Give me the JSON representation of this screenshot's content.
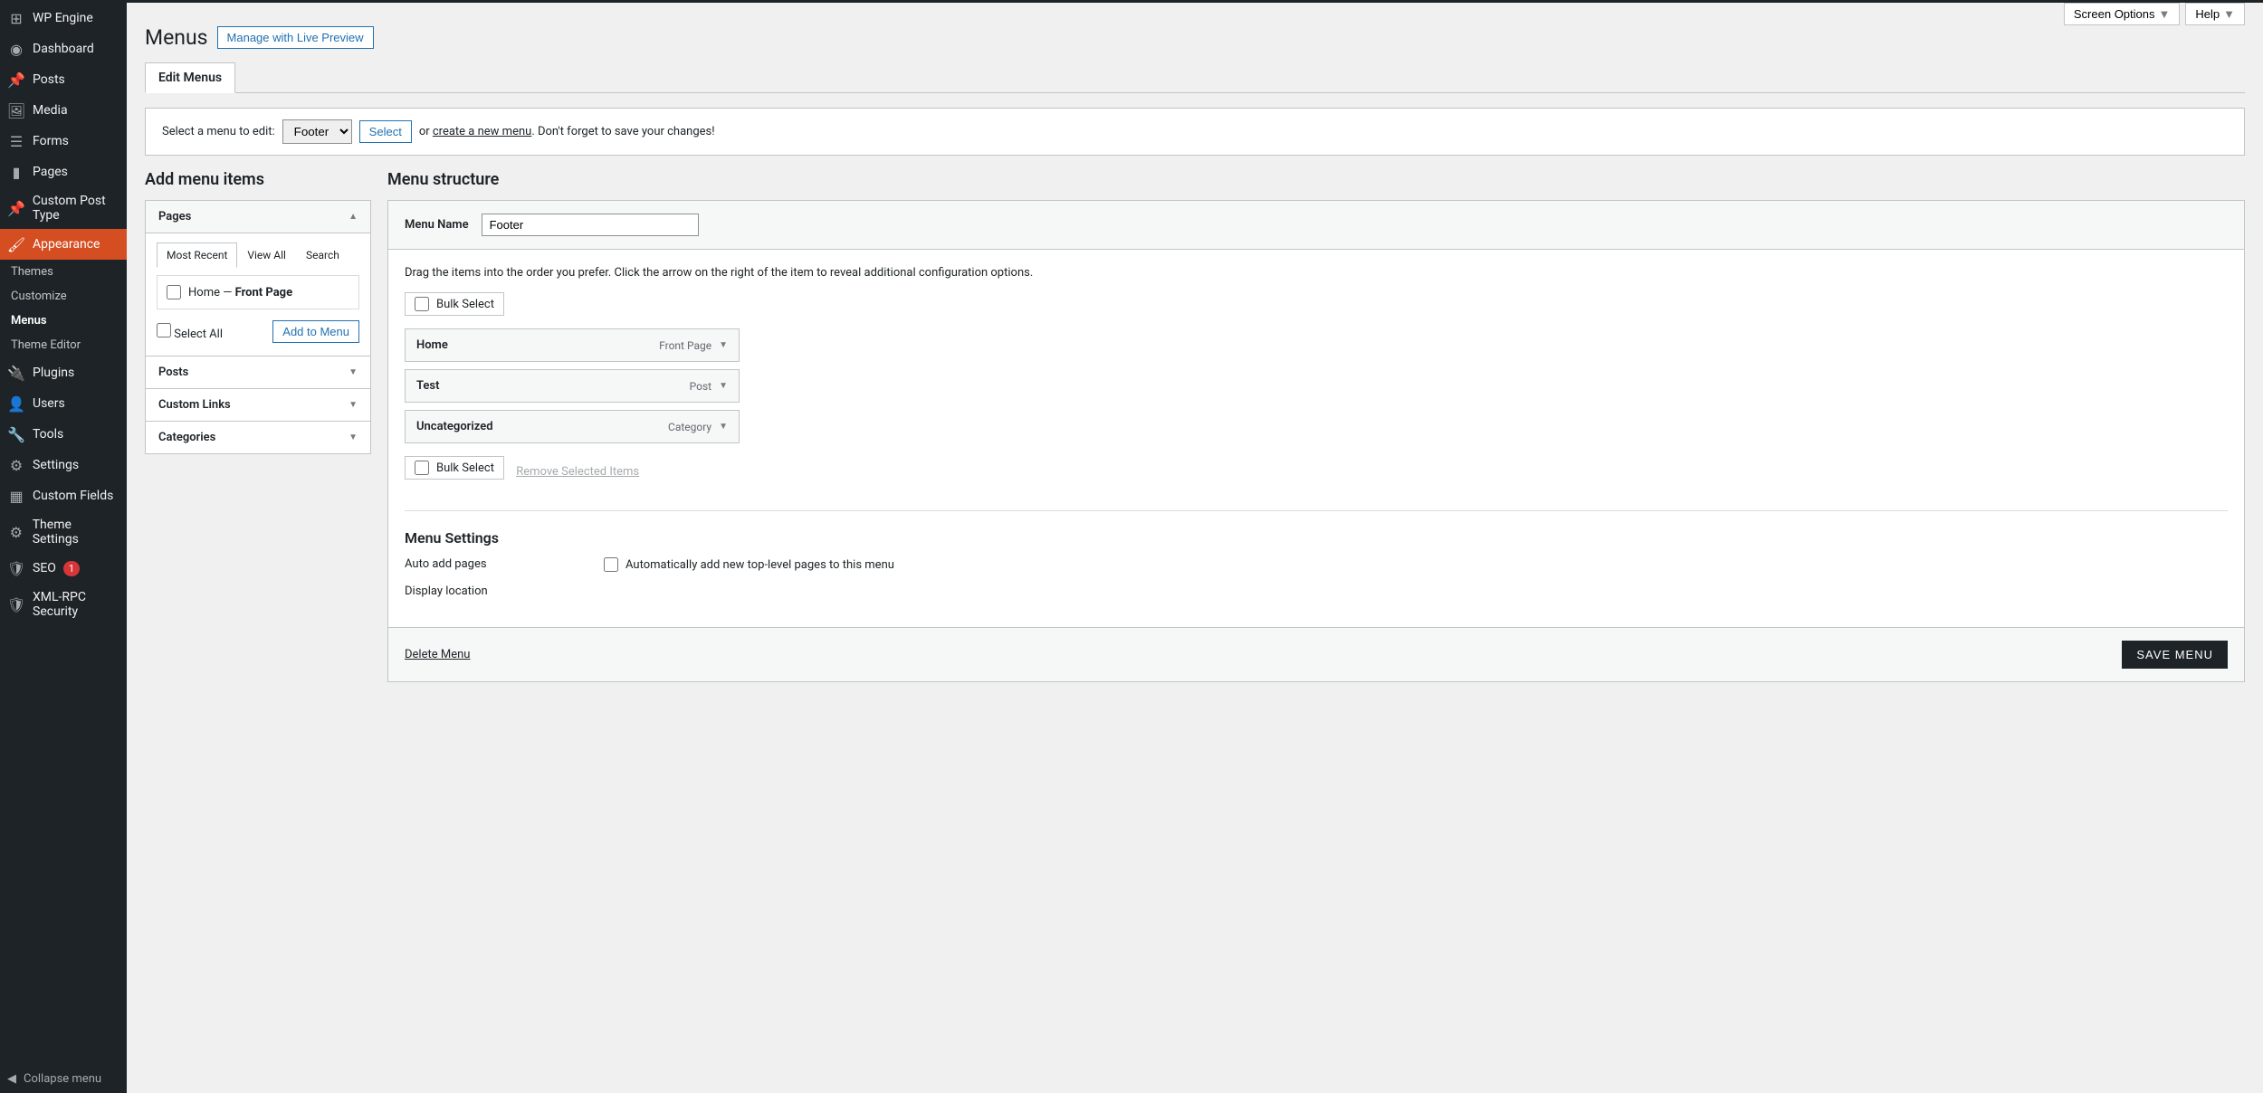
{
  "top": {
    "screen_options": "Screen Options",
    "help": "Help"
  },
  "page": {
    "title": "Menus",
    "live_preview": "Manage with Live Preview",
    "tab": "Edit Menus"
  },
  "select_bar": {
    "label": "Select a menu to edit:",
    "options": [
      "Footer"
    ],
    "select_btn": "Select",
    "or": "or",
    "create_link": "create a new menu",
    "suffix": ". Don't forget to save your changes!"
  },
  "sidebar": {
    "items": [
      {
        "label": "WP Engine",
        "icon": "grid"
      },
      {
        "label": "Dashboard",
        "icon": "gauge"
      },
      {
        "label": "Posts",
        "icon": "pin"
      },
      {
        "label": "Media",
        "icon": "media"
      },
      {
        "label": "Forms",
        "icon": "form"
      },
      {
        "label": "Pages",
        "icon": "pages"
      },
      {
        "label": "Custom Post Type",
        "icon": "pin"
      },
      {
        "label": "Appearance",
        "icon": "brush",
        "active": true,
        "sub": [
          {
            "label": "Themes"
          },
          {
            "label": "Customize"
          },
          {
            "label": "Menus",
            "current": true
          },
          {
            "label": "Theme Editor"
          }
        ]
      },
      {
        "label": "Plugins",
        "icon": "plug"
      },
      {
        "label": "Users",
        "icon": "user"
      },
      {
        "label": "Tools",
        "icon": "wrench"
      },
      {
        "label": "Settings",
        "icon": "sliders"
      },
      {
        "label": "Custom Fields",
        "icon": "fields"
      },
      {
        "label": "Theme Settings",
        "icon": "gear"
      },
      {
        "label": "SEO",
        "icon": "shield",
        "badge": "1"
      },
      {
        "label": "XML-RPC Security",
        "icon": "shield2"
      }
    ],
    "collapse": "Collapse menu"
  },
  "add_items": {
    "title": "Add menu items",
    "pages_label": "Pages",
    "tabs": {
      "recent": "Most Recent",
      "view_all": "View All",
      "search": "Search"
    },
    "page_item_prefix": "Home — ",
    "page_item_strong": "Front Page",
    "select_all": "Select All",
    "add_btn": "Add to Menu",
    "posts": "Posts",
    "custom_links": "Custom Links",
    "categories": "Categories"
  },
  "structure": {
    "title": "Menu structure",
    "name_label": "Menu Name",
    "name_value": "Footer",
    "hint": "Drag the items into the order you prefer. Click the arrow on the right of the item to reveal additional configuration options.",
    "bulk": "Bulk Select",
    "items": [
      {
        "title": "Home",
        "type": "Front Page"
      },
      {
        "title": "Test",
        "type": "Post"
      },
      {
        "title": "Uncategorized",
        "type": "Category"
      }
    ],
    "remove_selected": "Remove Selected Items",
    "settings_title": "Menu Settings",
    "auto_add": "Auto add pages",
    "auto_add_check": "Automatically add new top-level pages to this menu",
    "display_location": "Display location",
    "delete": "Delete Menu",
    "save": "SAVE MENU"
  }
}
